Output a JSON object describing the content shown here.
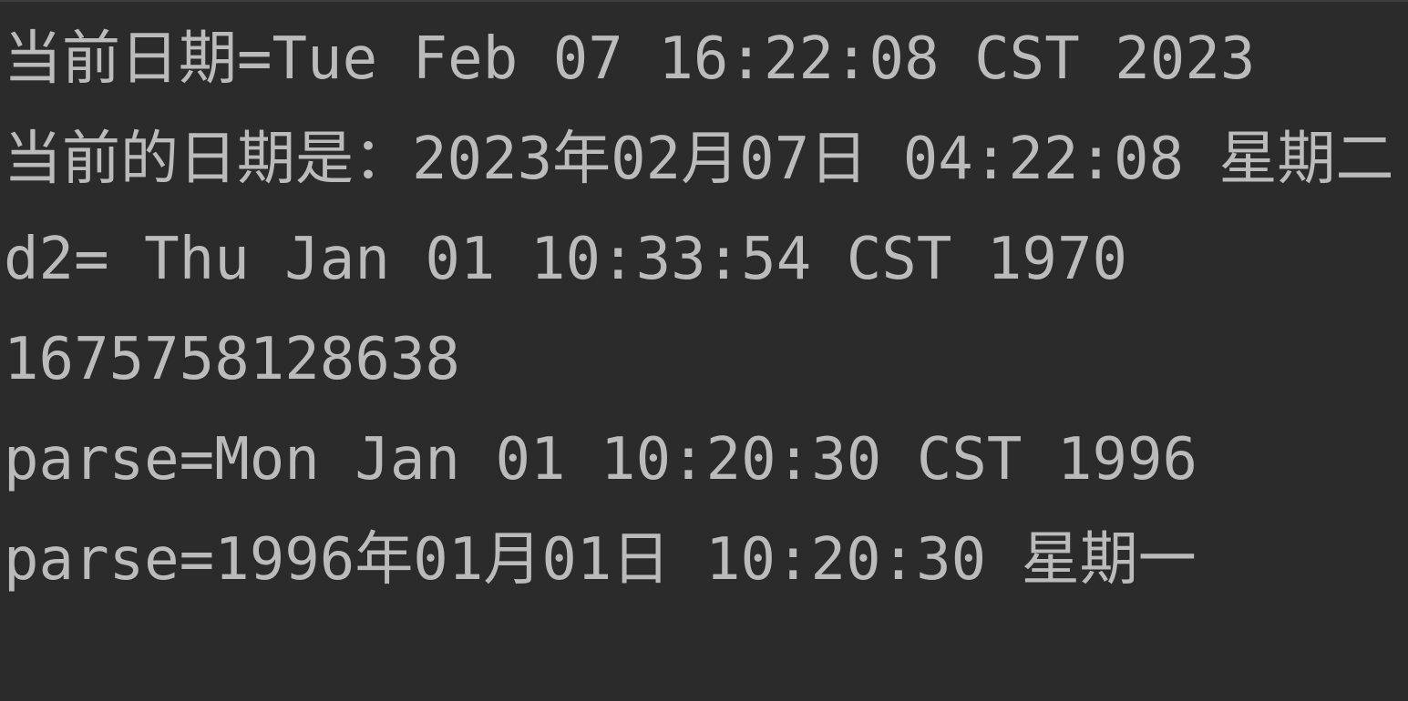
{
  "console": {
    "lines": [
      "当前日期=Tue Feb 07 16:22:08 CST 2023",
      "当前的日期是：2023年02月07日 04:22:08 星期二",
      "d2= Thu Jan 01 10:33:54 CST 1970",
      "1675758128638",
      "parse=Mon Jan 01 10:20:30 CST 1996",
      "parse=1996年01月01日 10:20:30 星期一"
    ]
  },
  "colors": {
    "background": "#2b2b2b",
    "text": "#bbbbbb"
  }
}
